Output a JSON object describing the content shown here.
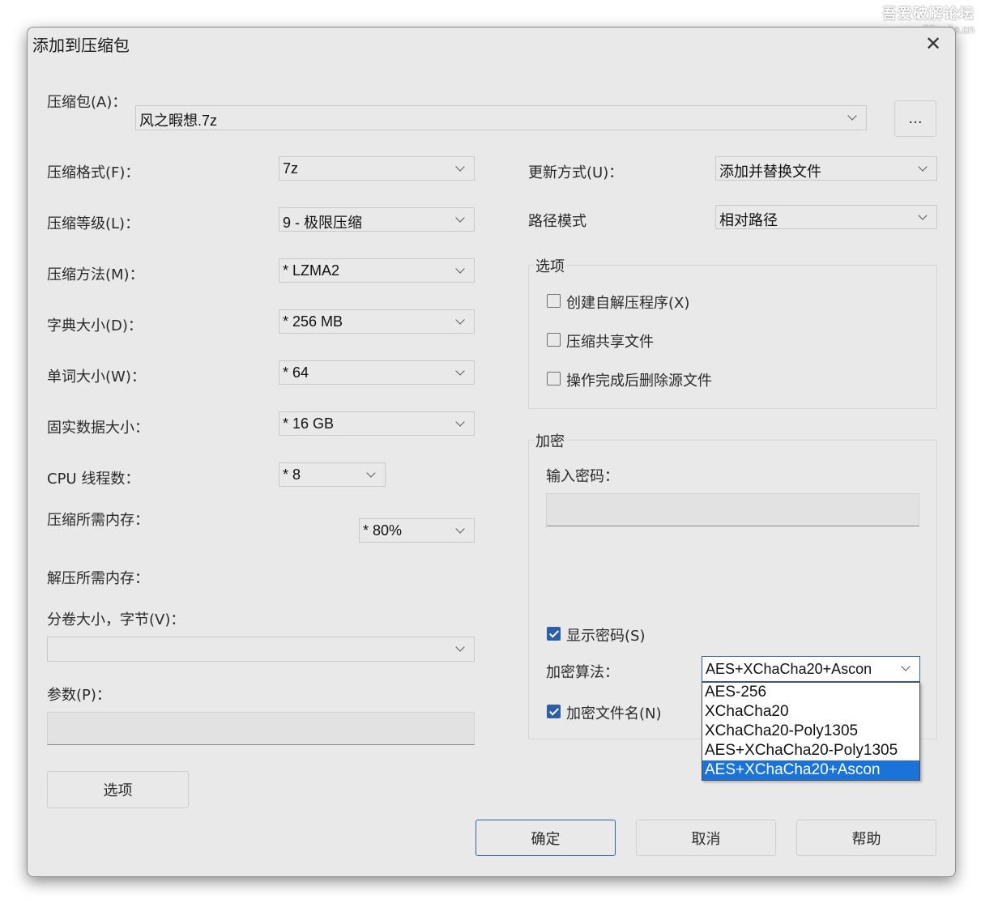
{
  "watermark": {
    "line1": "吾爱破解论坛",
    "line2": "www.52pojie.cn"
  },
  "window": {
    "title": "添加到压缩包",
    "close_glyph": "✕"
  },
  "archive": {
    "label": "压缩包(A)：",
    "value": "风之暇想.7z",
    "browse_label": "..."
  },
  "left_labels": {
    "format": "压缩格式(F)：",
    "level": "压缩等级(L)：",
    "method": "压缩方法(M)：",
    "dict": "字典大小(D)：",
    "word": "单词大小(W)：",
    "solid": "固实数据大小：",
    "threads": "CPU 线程数：",
    "mem_comp": "压缩所需内存：",
    "mem_decomp": "解压所需内存：",
    "volume": "分卷大小，字节(V)：",
    "params": "参数(P)："
  },
  "left_values": {
    "format": "7z",
    "level": "9 - 极限压缩",
    "method": "*  LZMA2",
    "dict": "*  256 MB",
    "word": "*  64",
    "solid": "*  16 GB",
    "threads": "*  8",
    "mem_comp": "*  80%",
    "volume": ""
  },
  "options_button": "选项",
  "right": {
    "update_label": "更新方式(U)：",
    "update_value": "添加并替换文件",
    "path_label": "路径模式",
    "path_value": "相对路径"
  },
  "options_group": {
    "title": "选项",
    "sfx": "创建自解压程序(X)",
    "shared": "压缩共享文件",
    "delete": "操作完成后删除源文件"
  },
  "encryption": {
    "title": "加密",
    "password_label": "输入密码：",
    "show_password": "显示密码(S)",
    "method_label": "加密算法：",
    "method_value": "AES+XChaCha20+Ascon",
    "encrypt_names": "加密文件名(N)",
    "options": [
      "AES-256",
      "XChaCha20",
      "XChaCha20-Poly1305",
      "AES+XChaCha20-Poly1305",
      "AES+XChaCha20+Ascon"
    ],
    "selected_index": 4
  },
  "checkbox_states": {
    "sfx": false,
    "shared": false,
    "delete": false,
    "show_password": true,
    "encrypt_names": true
  },
  "buttons": {
    "ok": "确定",
    "cancel": "取消",
    "help": "帮助"
  }
}
